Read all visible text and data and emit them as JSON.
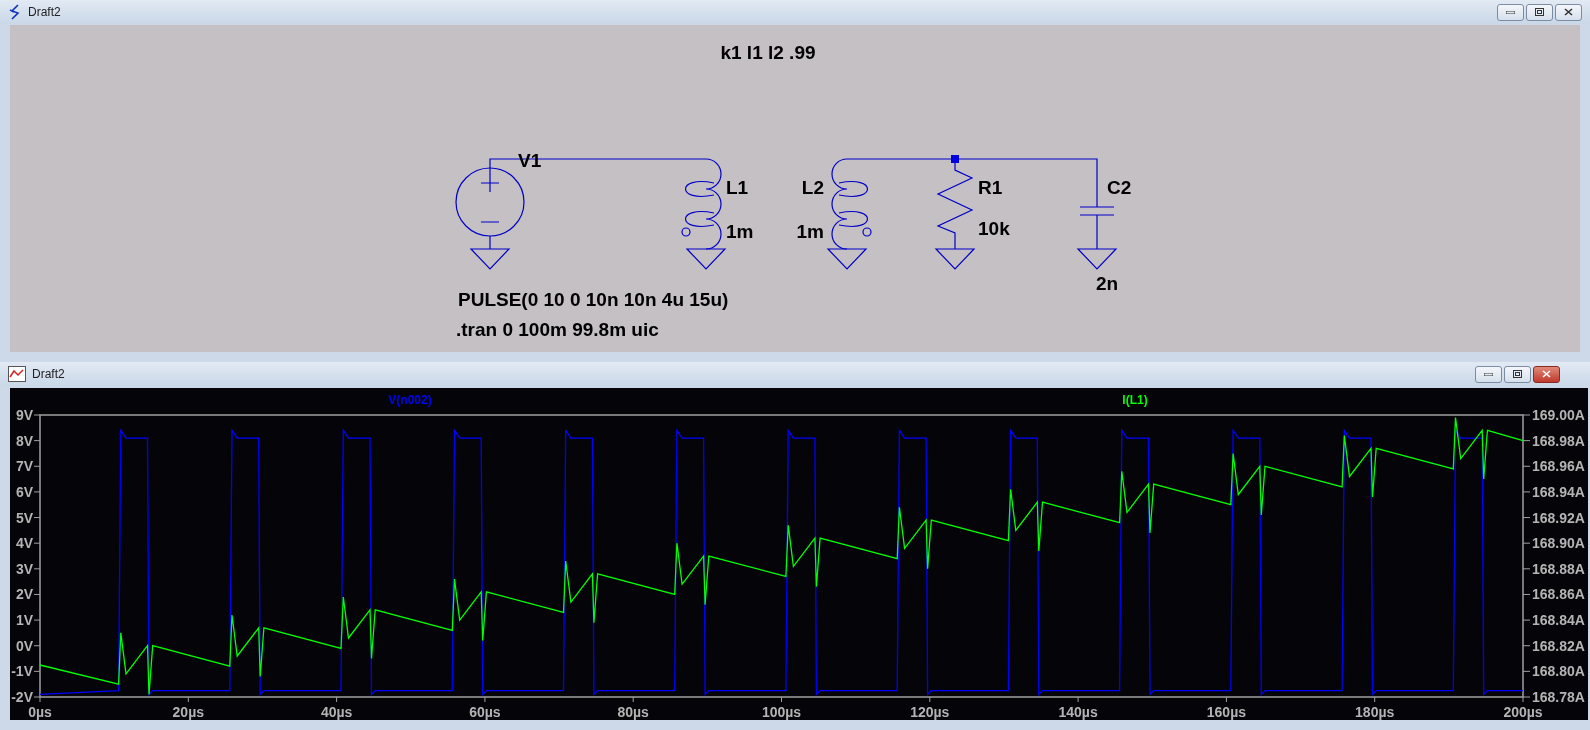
{
  "windows": [
    {
      "title": "Draft2",
      "kind": "schematic",
      "active": false
    },
    {
      "title": "Draft2",
      "kind": "waveform",
      "active": true
    }
  ],
  "schematic": {
    "directives": [
      "k1 l1 l2 .99",
      ".tran 0 100m 99.8m uic"
    ],
    "components": [
      {
        "kind": "voltage-source",
        "ref": "V1",
        "value": "PULSE(0 10 0 10n 10n 4u 15u)"
      },
      {
        "kind": "inductor",
        "ref": "L1",
        "value": "1m"
      },
      {
        "kind": "inductor",
        "ref": "L2",
        "value": "1m"
      },
      {
        "kind": "resistor",
        "ref": "R1",
        "value": "10k"
      },
      {
        "kind": "capacitor",
        "ref": "C2",
        "value": "2n"
      }
    ]
  },
  "waveform": {
    "chart_data": {
      "type": "line",
      "x": [
        0,
        10.6,
        10.9,
        11.6,
        14.5,
        14.7,
        15.2,
        25.6,
        25.9,
        26.6,
        29.5,
        29.7,
        30.2,
        40.6,
        40.9,
        41.6,
        44.5,
        44.7,
        45.2,
        55.6,
        55.9,
        56.6,
        59.5,
        59.7,
        60.2,
        70.6,
        70.9,
        71.6,
        74.5,
        74.7,
        75.2,
        85.6,
        85.9,
        86.6,
        89.5,
        89.7,
        90.2,
        100.6,
        100.9,
        101.6,
        104.5,
        104.7,
        105.2,
        115.6,
        115.9,
        116.6,
        119.5,
        119.7,
        120.2,
        130.6,
        130.9,
        131.6,
        134.5,
        134.7,
        135.2,
        145.6,
        145.9,
        146.6,
        149.5,
        149.7,
        150.2,
        160.6,
        160.9,
        161.6,
        164.5,
        164.7,
        165.2,
        175.6,
        175.9,
        176.6,
        179.5,
        179.7,
        180.2,
        190.6,
        190.9,
        191.6,
        194.5,
        194.7,
        195.2,
        200
      ],
      "xlim": [
        0,
        200
      ],
      "xticks": [
        {
          "value": 0,
          "label": "0µs"
        },
        {
          "value": 20,
          "label": "20µs"
        },
        {
          "value": 40,
          "label": "40µs"
        },
        {
          "value": 60,
          "label": "60µs"
        },
        {
          "value": 80,
          "label": "80µs"
        },
        {
          "value": 100,
          "label": "100µs"
        },
        {
          "value": 120,
          "label": "120µs"
        },
        {
          "value": 140,
          "label": "140µs"
        },
        {
          "value": 160,
          "label": "160µs"
        },
        {
          "value": 180,
          "label": "180µs"
        },
        {
          "value": 200,
          "label": "200µs"
        }
      ],
      "ylim": [
        -2,
        9
      ],
      "yticks": [
        {
          "value": 9,
          "label": "9V"
        },
        {
          "value": 8,
          "label": "8V"
        },
        {
          "value": 7,
          "label": "7V"
        },
        {
          "value": 6,
          "label": "6V"
        },
        {
          "value": 5,
          "label": "5V"
        },
        {
          "value": 4,
          "label": "4V"
        },
        {
          "value": 3,
          "label": "3V"
        },
        {
          "value": 2,
          "label": "2V"
        },
        {
          "value": 1,
          "label": "1V"
        },
        {
          "value": 0,
          "label": "0V"
        },
        {
          "value": -1,
          "label": "-1V"
        },
        {
          "value": -2,
          "label": "-2V"
        }
      ],
      "y2lim": [
        168.78,
        169.0
      ],
      "y2ticks": [
        {
          "value": 169.0,
          "label": "169.00A"
        },
        {
          "value": 168.98,
          "label": "168.98A"
        },
        {
          "value": 168.96,
          "label": "168.96A"
        },
        {
          "value": 168.94,
          "label": "168.94A"
        },
        {
          "value": 168.92,
          "label": "168.92A"
        },
        {
          "value": 168.9,
          "label": "168.90A"
        },
        {
          "value": 168.88,
          "label": "168.88A"
        },
        {
          "value": 168.86,
          "label": "168.86A"
        },
        {
          "value": 168.84,
          "label": "168.84A"
        },
        {
          "value": 168.82,
          "label": "168.82A"
        },
        {
          "value": 168.8,
          "label": "168.80A"
        },
        {
          "value": 168.78,
          "label": "168.78A"
        }
      ],
      "series": [
        {
          "name": "V(n002)",
          "color": "#0000ff",
          "values": [
            -1.9,
            -1.75,
            8.4,
            8.1,
            8.1,
            -1.9,
            -1.75,
            -1.75,
            8.4,
            8.1,
            8.1,
            -1.9,
            -1.75,
            -1.75,
            8.4,
            8.1,
            8.1,
            -1.9,
            -1.75,
            -1.75,
            8.4,
            8.1,
            8.1,
            -1.9,
            -1.75,
            -1.75,
            8.4,
            8.1,
            8.1,
            -1.9,
            -1.75,
            -1.75,
            8.4,
            8.1,
            8.1,
            -1.9,
            -1.75,
            -1.75,
            8.4,
            8.1,
            8.1,
            -1.9,
            -1.75,
            -1.75,
            8.4,
            8.1,
            8.1,
            -1.9,
            -1.75,
            -1.75,
            8.4,
            8.1,
            8.1,
            -1.9,
            -1.75,
            -1.75,
            8.4,
            8.1,
            8.1,
            -1.9,
            -1.75,
            -1.75,
            8.4,
            8.1,
            8.1,
            -1.9,
            -1.75,
            -1.75,
            8.4,
            8.1,
            8.1,
            -1.9,
            -1.75,
            -1.75,
            8.4,
            8.1,
            8.1,
            -1.9,
            -1.75,
            -1.75
          ]
        },
        {
          "name": "I(L1)",
          "color": "#00ff00",
          "axis": "y2",
          "values": [
            168.805,
            168.79,
            168.83,
            168.798,
            168.82,
            168.782,
            168.82,
            168.804,
            168.844,
            168.812,
            168.834,
            168.796,
            168.834,
            168.818,
            168.858,
            168.826,
            168.848,
            168.81,
            168.848,
            168.832,
            168.872,
            168.84,
            168.862,
            168.824,
            168.862,
            168.846,
            168.886,
            168.854,
            168.876,
            168.838,
            168.876,
            168.86,
            168.9,
            168.868,
            168.89,
            168.852,
            168.89,
            168.874,
            168.914,
            168.882,
            168.904,
            168.866,
            168.904,
            168.888,
            168.928,
            168.896,
            168.918,
            168.88,
            168.918,
            168.902,
            168.942,
            168.91,
            168.932,
            168.894,
            168.932,
            168.916,
            168.956,
            168.924,
            168.946,
            168.908,
            168.946,
            168.93,
            168.97,
            168.938,
            168.96,
            168.922,
            168.96,
            168.944,
            168.984,
            168.952,
            168.974,
            168.936,
            168.974,
            168.958,
            168.998,
            168.966,
            168.988,
            168.95,
            168.988,
            168.98
          ]
        }
      ]
    }
  }
}
